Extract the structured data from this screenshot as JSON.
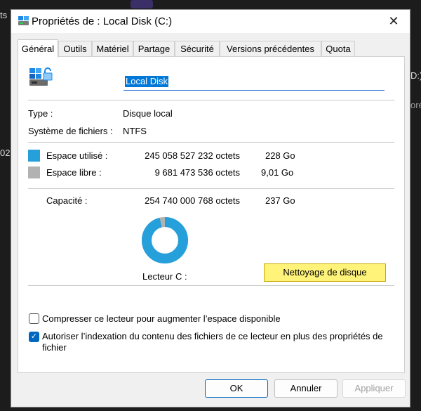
{
  "background": {
    "left_fragments": [
      "ts",
      "02."
    ],
    "right_fragments": [
      "D:)",
      "ore"
    ]
  },
  "window": {
    "title": "Propriétés de : Local Disk (C:)",
    "close_glyph": "✕",
    "icon": "drive-properties-icon"
  },
  "tabs": [
    "Général",
    "Outils",
    "Matériel",
    "Partage",
    "Sécurité",
    "Versions précédentes",
    "Quota"
  ],
  "general": {
    "drive_icon": "drive-with-lock-icon",
    "name_value": "Local Disk",
    "type_label": "Type :",
    "type_value": "Disque local",
    "fs_label": "Système de fichiers :",
    "fs_value": "NTFS",
    "used_label": "Espace utilisé :",
    "used_bytes": "245 058 527 232 octets",
    "used_size": "228 Go",
    "free_label": "Espace libre :",
    "free_bytes": "9 681 473 536 octets",
    "free_size": "9,01 Go",
    "capacity_label": "Capacité :",
    "capacity_bytes": "254 740 000 768 octets",
    "capacity_size": "237 Go",
    "drive_label": "Lecteur C :",
    "cleanup_button": "Nettoyage de disque",
    "used_fraction": 0.962,
    "compress_label": "Compresser ce lecteur pour augmenter l’espace disponible",
    "compress_checked": false,
    "index_label": "Autoriser l’indexation du contenu des fichiers de ce lecteur en plus des propriétés de fichier",
    "index_checked": true
  },
  "colors": {
    "used": "#26a0da",
    "free": "#b2b2b2",
    "highlight": "#fff37a"
  },
  "buttons": {
    "ok": "OK",
    "cancel": "Annuler",
    "apply": "Appliquer"
  }
}
